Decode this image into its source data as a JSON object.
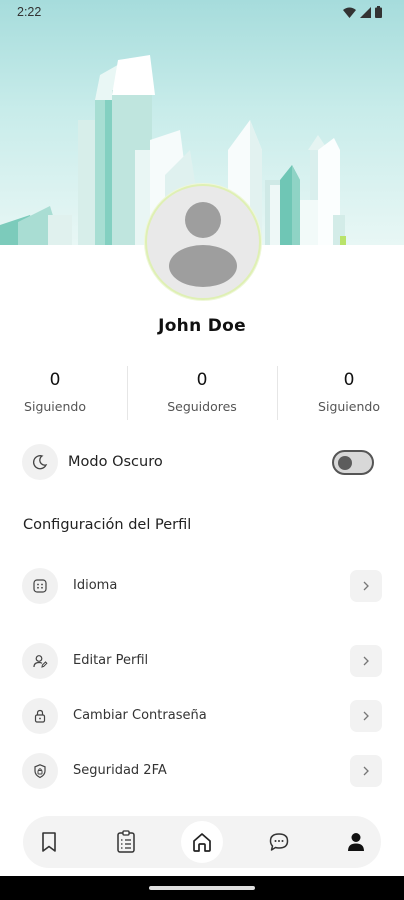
{
  "status_bar": {
    "time": "2:22"
  },
  "profile": {
    "name": "John Doe"
  },
  "stats": [
    {
      "value": "0",
      "label": "Siguiendo"
    },
    {
      "value": "0",
      "label": "Seguidores"
    },
    {
      "value": "0",
      "label": "Siguiendo"
    }
  ],
  "dark_mode": {
    "label": "Modo Oscuro",
    "enabled": false
  },
  "settings": {
    "title": "Configuración del Perfil",
    "items": [
      {
        "label": "Idioma",
        "icon": "language-icon"
      },
      {
        "label": "Editar Perfil",
        "icon": "edit-user-icon"
      },
      {
        "label": "Cambiar Contraseña",
        "icon": "lock-icon"
      },
      {
        "label": "Seguridad 2FA",
        "icon": "shield-icon"
      }
    ]
  },
  "bottom_nav": {
    "items": [
      "bookmark-icon",
      "clipboard-list-icon",
      "home-icon",
      "chat-icon",
      "profile-icon"
    ],
    "active": "home-icon"
  },
  "colors": {
    "accent": "#dff0b4",
    "banner_sky": "#a6dcdc",
    "building_teal": "#6fc6b5"
  }
}
